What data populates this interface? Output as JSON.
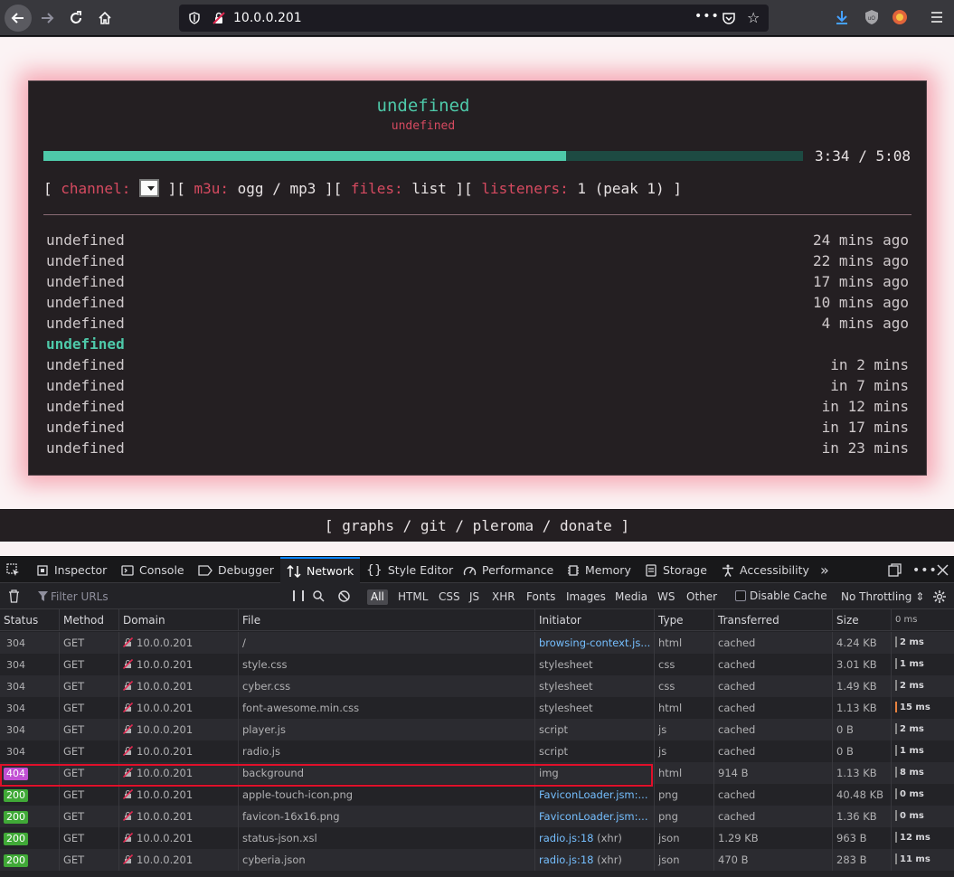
{
  "browser": {
    "url": "10.0.0.201"
  },
  "player": {
    "title": "undefined",
    "subtitle": "undefined",
    "progress": 0.688,
    "time": "3:34 / 5:08",
    "controls": {
      "open1": "[ ",
      "channel_label": "channel:",
      "sep1": " ][ ",
      "m3u_label": "m3u:",
      "m3u_value": " ogg / mp3",
      "sep2": " ][ ",
      "files_label": "files:",
      "files_value": " list",
      "sep3": " ][ ",
      "listeners_label": "listeners:",
      "listeners_value": " 1 (peak 1) ]"
    },
    "history": [
      {
        "title": "undefined",
        "time": "24 mins ago"
      },
      {
        "title": "undefined",
        "time": "22 mins ago"
      },
      {
        "title": "undefined",
        "time": "17 mins ago"
      },
      {
        "title": "undefined",
        "time": "10 mins ago"
      },
      {
        "title": "undefined",
        "time": "4 mins ago"
      },
      {
        "title": "undefined",
        "time": "",
        "current": true
      },
      {
        "title": "undefined",
        "time": "in 2 mins"
      },
      {
        "title": "undefined",
        "time": "in 7 mins"
      },
      {
        "title": "undefined",
        "time": "in 12 mins"
      },
      {
        "title": "undefined",
        "time": "in 17 mins"
      },
      {
        "title": "undefined",
        "time": "in 23 mins"
      }
    ],
    "footer": "[ graphs / git / pleroma / donate ]"
  },
  "devtools": {
    "tabs": [
      "Inspector",
      "Console",
      "Debugger",
      "Network",
      "Style Editor",
      "Performance",
      "Memory",
      "Storage",
      "Accessibility"
    ],
    "active_tab": "Network",
    "filter_placeholder": "Filter URLs",
    "types": [
      "All",
      "HTML",
      "CSS",
      "JS",
      "XHR",
      "Fonts",
      "Images",
      "Media",
      "WS",
      "Other"
    ],
    "disable_cache": "Disable Cache",
    "throttling": "No Throttling ⇕",
    "columns": [
      "Status",
      "Method",
      "Domain",
      "File",
      "Initiator",
      "Type",
      "Transferred",
      "Size",
      "0 ms"
    ],
    "rows": [
      {
        "status": "304",
        "method": "GET",
        "domain": "10.0.0.201",
        "file": "/",
        "initiator": "browsing-context.js...",
        "init_link": true,
        "type": "html",
        "transferred": "cached",
        "size": "4.24 KB",
        "time": "2 ms"
      },
      {
        "status": "304",
        "method": "GET",
        "domain": "10.0.0.201",
        "file": "style.css",
        "initiator": "stylesheet",
        "init_link": false,
        "type": "css",
        "transferred": "cached",
        "size": "3.01 KB",
        "time": "1 ms"
      },
      {
        "status": "304",
        "method": "GET",
        "domain": "10.0.0.201",
        "file": "cyber.css",
        "initiator": "stylesheet",
        "init_link": false,
        "type": "css",
        "transferred": "cached",
        "size": "1.49 KB",
        "time": "2 ms"
      },
      {
        "status": "304",
        "method": "GET",
        "domain": "10.0.0.201",
        "file": "font-awesome.min.css",
        "initiator": "stylesheet",
        "init_link": false,
        "type": "html",
        "transferred": "cached",
        "size": "1.13 KB",
        "time": "15 ms"
      },
      {
        "status": "304",
        "method": "GET",
        "domain": "10.0.0.201",
        "file": "player.js",
        "initiator": "script",
        "init_link": false,
        "type": "js",
        "transferred": "cached",
        "size": "0 B",
        "time": "2 ms"
      },
      {
        "status": "304",
        "method": "GET",
        "domain": "10.0.0.201",
        "file": "radio.js",
        "initiator": "script",
        "init_link": false,
        "type": "js",
        "transferred": "cached",
        "size": "0 B",
        "time": "1 ms"
      },
      {
        "status": "404",
        "method": "GET",
        "domain": "10.0.0.201",
        "file": "background",
        "initiator": "img",
        "init_link": false,
        "type": "html",
        "transferred": "914 B",
        "size": "1.13 KB",
        "time": "8 ms"
      },
      {
        "status": "200",
        "method": "GET",
        "domain": "10.0.0.201",
        "file": "apple-touch-icon.png",
        "initiator": "FaviconLoader.jsm:...",
        "init_link": true,
        "type": "png",
        "transferred": "cached",
        "size": "40.48 KB",
        "time": "0 ms"
      },
      {
        "status": "200",
        "method": "GET",
        "domain": "10.0.0.201",
        "file": "favicon-16x16.png",
        "initiator": "FaviconLoader.jsm:...",
        "init_link": true,
        "type": "png",
        "transferred": "cached",
        "size": "1.36 KB",
        "time": "0 ms"
      },
      {
        "status": "200",
        "method": "GET",
        "domain": "10.0.0.201",
        "file": "status-json.xsl",
        "initiator": "radio.js:18",
        "init_suffix": " (xhr)",
        "init_link": true,
        "type": "json",
        "transferred": "1.29 KB",
        "size": "963 B",
        "time": "12 ms"
      },
      {
        "status": "200",
        "method": "GET",
        "domain": "10.0.0.201",
        "file": "cyberia.json",
        "initiator": "radio.js:18",
        "init_suffix": " (xhr)",
        "init_link": true,
        "type": "json",
        "transferred": "470 B",
        "size": "283 B",
        "time": "11 ms"
      }
    ]
  }
}
